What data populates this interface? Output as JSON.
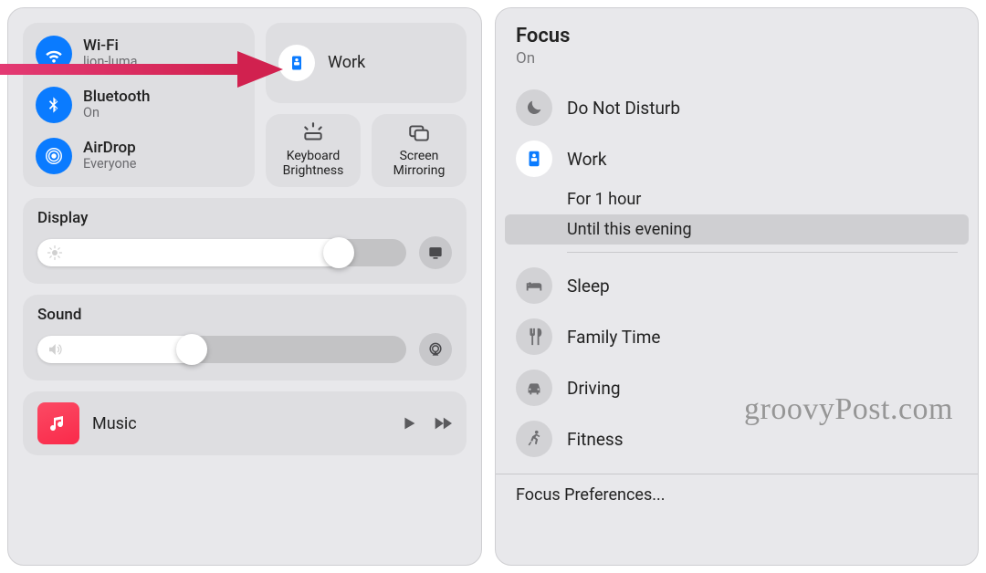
{
  "left": {
    "wifi": {
      "title": "Wi-Fi",
      "sub": "lion-luma"
    },
    "bluetooth": {
      "title": "Bluetooth",
      "sub": "On"
    },
    "airdrop": {
      "title": "AirDrop",
      "sub": "Everyone"
    },
    "focus": {
      "label": "Work"
    },
    "keyboard_brightness": "Keyboard\nBrightness",
    "screen_mirroring": "Screen\nMirroring",
    "display": {
      "title": "Display",
      "percent": 85
    },
    "sound": {
      "title": "Sound",
      "percent": 45
    },
    "music": {
      "title": "Music"
    }
  },
  "right": {
    "title": "Focus",
    "status": "On",
    "modes": {
      "dnd": "Do Not Disturb",
      "work": "Work",
      "sleep": "Sleep",
      "family": "Family Time",
      "driving": "Driving",
      "fitness": "Fitness"
    },
    "durations": {
      "hour": "For 1 hour",
      "evening": "Until this evening"
    },
    "prefs": "Focus Preferences..."
  },
  "watermark": "groovyPost.com",
  "colors": {
    "accent": "#0a7bff",
    "arrow": "#d1214f"
  }
}
